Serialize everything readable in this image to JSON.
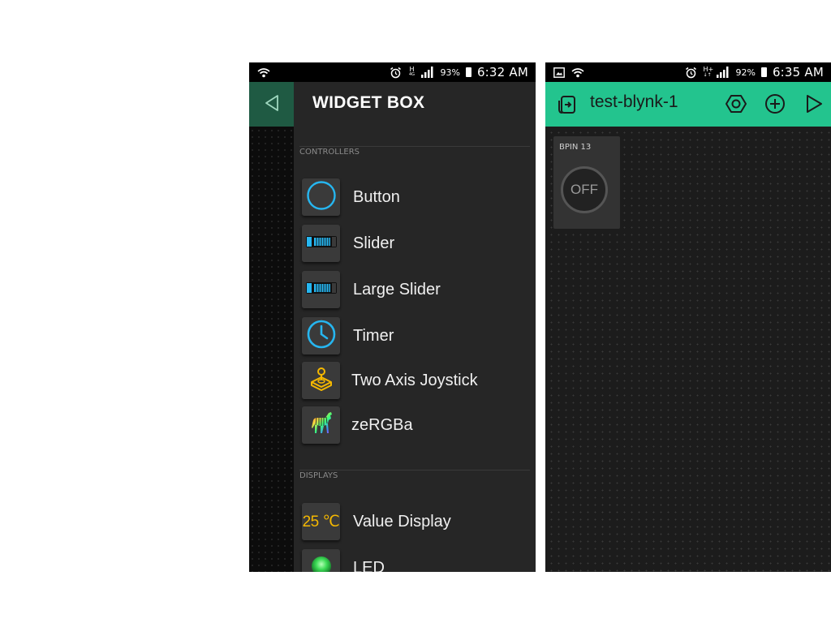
{
  "left_phone": {
    "status": {
      "net_type_top": "H",
      "net_type_bottom": "4G",
      "battery": "93%",
      "time": "6:32 AM"
    },
    "drawer": {
      "title": "WIDGET BOX",
      "sections": [
        {
          "label": "CONTROLLERS",
          "items": [
            {
              "label": "Button",
              "icon": "button-circle-icon"
            },
            {
              "label": "Slider",
              "icon": "slider-icon"
            },
            {
              "label": "Large Slider",
              "icon": "large-slider-icon"
            },
            {
              "label": "Timer",
              "icon": "clock-icon"
            },
            {
              "label": "Two Axis Joystick",
              "icon": "joystick-icon"
            },
            {
              "label": "zeRGBa",
              "icon": "zebra-icon"
            }
          ]
        },
        {
          "label": "DISPLAYS",
          "items": [
            {
              "label": "Value Display",
              "icon": "value-display-icon",
              "icon_text": "25 ℃"
            },
            {
              "label": "LED",
              "icon": "led-icon"
            }
          ]
        }
      ]
    }
  },
  "right_phone": {
    "status": {
      "net_type_top": "H+",
      "net_type_bottom": "↓↑",
      "battery": "92%",
      "time": "6:35 AM"
    },
    "app_bar": {
      "title": "test-blynk-1"
    },
    "widgets": [
      {
        "pin_label": "BPIN 13",
        "state": "OFF"
      }
    ]
  },
  "colors": {
    "brand_green": "#23c48e",
    "drawer_header_green": "#1f5a43",
    "accent_blue": "#26b6f0",
    "accent_yellow": "#f5b800",
    "led_green": "#3ddc56"
  }
}
